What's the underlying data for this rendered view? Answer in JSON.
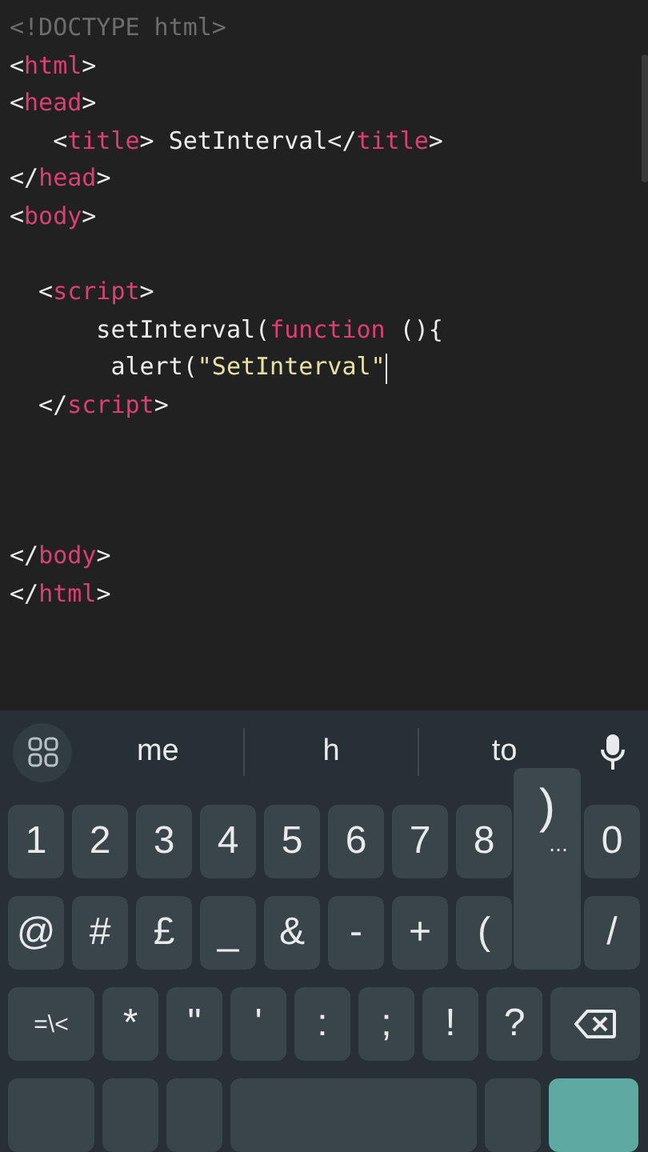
{
  "editor": {
    "lines": [
      {
        "kind": "code",
        "cursor": false,
        "tokens": [
          {
            "kind": "doctype",
            "text": "<!DOCTYPE html>"
          }
        ]
      },
      {
        "kind": "code",
        "cursor": false,
        "tokens": [
          {
            "kind": "punct",
            "text": "<"
          },
          {
            "kind": "tag",
            "text": "html"
          },
          {
            "kind": "punct",
            "text": ">"
          }
        ]
      },
      {
        "kind": "code",
        "cursor": false,
        "tokens": [
          {
            "kind": "punct",
            "text": "<"
          },
          {
            "kind": "tag",
            "text": "head"
          },
          {
            "kind": "punct",
            "text": ">"
          }
        ]
      },
      {
        "kind": "code",
        "cursor": false,
        "tokens": [
          {
            "kind": "punct",
            "text": "   <"
          },
          {
            "kind": "tag",
            "text": "title"
          },
          {
            "kind": "punct",
            "text": "> SetInterval</"
          },
          {
            "kind": "tag",
            "text": "title"
          },
          {
            "kind": "punct",
            "text": ">"
          }
        ]
      },
      {
        "kind": "code",
        "cursor": false,
        "tokens": [
          {
            "kind": "punct",
            "text": "</"
          },
          {
            "kind": "tag",
            "text": "head"
          },
          {
            "kind": "punct",
            "text": ">"
          }
        ]
      },
      {
        "kind": "code",
        "cursor": false,
        "tokens": [
          {
            "kind": "punct",
            "text": "<"
          },
          {
            "kind": "tag",
            "text": "body"
          },
          {
            "kind": "punct",
            "text": ">"
          }
        ]
      },
      {
        "kind": "blank"
      },
      {
        "kind": "code",
        "cursor": false,
        "tokens": [
          {
            "kind": "punct",
            "text": "  <"
          },
          {
            "kind": "tag",
            "text": "script"
          },
          {
            "kind": "punct",
            "text": ">"
          }
        ]
      },
      {
        "kind": "code",
        "cursor": false,
        "tokens": [
          {
            "kind": "punct",
            "text": "      setInterval("
          },
          {
            "kind": "keyword",
            "text": "function"
          },
          {
            "kind": "punct",
            "text": " (){"
          }
        ]
      },
      {
        "kind": "code",
        "cursor": true,
        "tokens": [
          {
            "kind": "punct",
            "text": "       alert("
          },
          {
            "kind": "string",
            "text": "\"SetInterval\""
          }
        ]
      },
      {
        "kind": "code",
        "cursor": false,
        "tokens": [
          {
            "kind": "punct",
            "text": "  </"
          },
          {
            "kind": "tag",
            "text": "script"
          },
          {
            "kind": "punct",
            "text": ">"
          }
        ]
      },
      {
        "kind": "blank"
      },
      {
        "kind": "blank"
      },
      {
        "kind": "blank"
      },
      {
        "kind": "code",
        "cursor": false,
        "tokens": [
          {
            "kind": "punct",
            "text": "</"
          },
          {
            "kind": "tag",
            "text": "body"
          },
          {
            "kind": "punct",
            "text": ">"
          }
        ]
      },
      {
        "kind": "code",
        "cursor": false,
        "tokens": [
          {
            "kind": "punct",
            "text": "</"
          },
          {
            "kind": "tag",
            "text": "html"
          },
          {
            "kind": "punct",
            "text": ">"
          }
        ]
      }
    ]
  },
  "keyboard": {
    "suggestions": [
      "me",
      "h",
      "to"
    ],
    "popup": {
      "label": ")",
      "more": "…"
    },
    "rows": [
      [
        {
          "kind": "key",
          "label": "1"
        },
        {
          "kind": "key",
          "label": "2"
        },
        {
          "kind": "key",
          "label": "3"
        },
        {
          "kind": "key",
          "label": "4"
        },
        {
          "kind": "key",
          "label": "5"
        },
        {
          "kind": "key",
          "label": "6"
        },
        {
          "kind": "key",
          "label": "7"
        },
        {
          "kind": "key",
          "label": "8"
        },
        {
          "kind": "covered"
        },
        {
          "kind": "key",
          "label": "0"
        }
      ],
      [
        {
          "kind": "key",
          "label": "@"
        },
        {
          "kind": "key",
          "label": "#"
        },
        {
          "kind": "key",
          "label": "£"
        },
        {
          "kind": "key",
          "label": "_"
        },
        {
          "kind": "key",
          "label": "&"
        },
        {
          "kind": "key",
          "label": "-"
        },
        {
          "kind": "key",
          "label": "+"
        },
        {
          "kind": "key",
          "label": "("
        },
        {
          "kind": "covered"
        },
        {
          "kind": "key",
          "label": "/"
        }
      ],
      [
        {
          "kind": "wide",
          "label": "=\\<"
        },
        {
          "kind": "key",
          "label": "*"
        },
        {
          "kind": "key",
          "label": "\""
        },
        {
          "kind": "key",
          "label": "'"
        },
        {
          "kind": "key",
          "label": ":"
        },
        {
          "kind": "key",
          "label": ";"
        },
        {
          "kind": "key",
          "label": "!"
        },
        {
          "kind": "key",
          "label": "?"
        },
        {
          "kind": "backspace"
        }
      ],
      [
        {
          "kind": "wide"
        },
        {
          "kind": "key"
        },
        {
          "kind": "key"
        },
        {
          "kind": "space"
        },
        {
          "kind": "key"
        },
        {
          "kind": "enter"
        }
      ]
    ]
  }
}
